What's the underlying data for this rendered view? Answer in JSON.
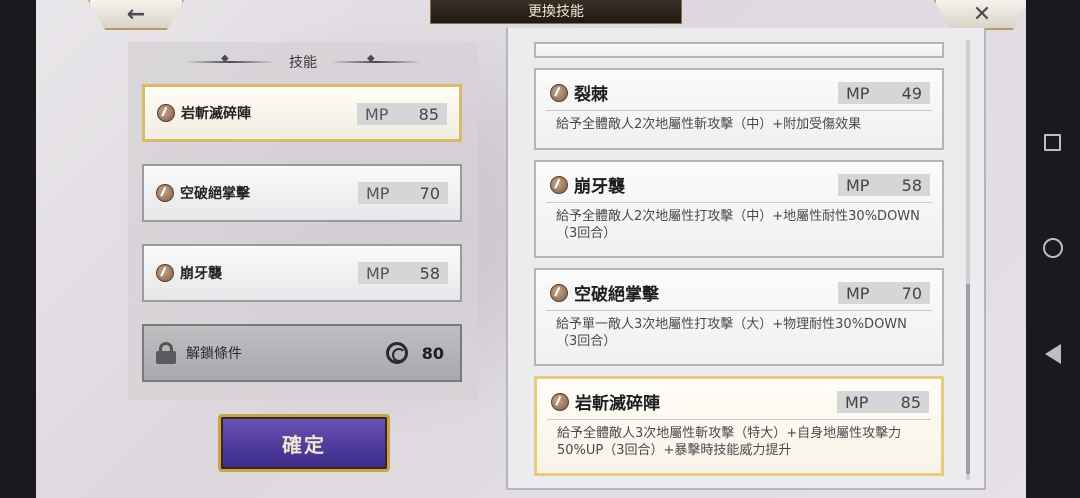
{
  "header": {
    "title": "更換技能",
    "back_icon": "←",
    "close_icon": "✕"
  },
  "left": {
    "heading": "技能",
    "slots": [
      {
        "name": "岩斬滅碎陣",
        "mp_label": "MP",
        "mp": "85",
        "selected": true
      },
      {
        "name": "空破絕掌擊",
        "mp_label": "MP",
        "mp": "70",
        "selected": false
      },
      {
        "name": "崩牙襲",
        "mp_label": "MP",
        "mp": "58",
        "selected": false
      }
    ],
    "locked_slot": {
      "label": "解鎖條件",
      "cost": "80",
      "icon": "spiral-icon"
    },
    "confirm_label": "確定"
  },
  "skills": [
    {
      "name": "裂棘",
      "mp_label": "MP",
      "mp": "49",
      "desc": "給予全體敵人2次地屬性斬攻擊（中）+附加受傷效果"
    },
    {
      "name": "崩牙襲",
      "mp_label": "MP",
      "mp": "58",
      "desc": "給予全體敵人2次地屬性打攻擊（中）+地屬性耐性30%DOWN（3回合）"
    },
    {
      "name": "空破絕掌擊",
      "mp_label": "MP",
      "mp": "70",
      "desc": "給予單一敵人3次地屬性打攻擊（大）+物理耐性30%DOWN（3回合）"
    },
    {
      "name": "岩斬滅碎陣",
      "mp_label": "MP",
      "mp": "85",
      "desc": "給予全體敵人3次地屬性斬攻擊（特大）+自身地屬性攻擊力50%UP（3回合）+暴擊時技能威力提升"
    }
  ],
  "colors": {
    "selected_border": "#d9b96a",
    "confirm_fill": "#4a3a9a",
    "confirm_border": "#c9a24c"
  }
}
